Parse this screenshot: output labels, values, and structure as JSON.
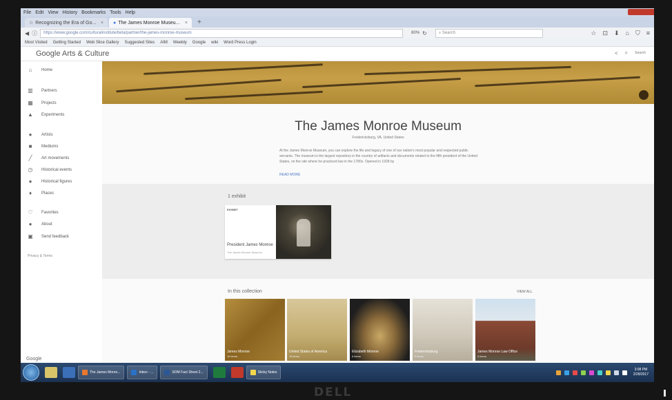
{
  "browser": {
    "menu": [
      "File",
      "Edit",
      "View",
      "History",
      "Bookmarks",
      "Tools",
      "Help"
    ],
    "tabs": [
      {
        "label": "Recognizing the Era of Go...",
        "active": false
      },
      {
        "label": "The James Monroe Museu...",
        "active": true
      }
    ],
    "url": "https://www.google.com/culturalinstitute/beta/partner/the-james-monroe-museum",
    "zoom": "80%",
    "search_placeholder": "Search",
    "bookmarks": [
      "Most Visited",
      "Getting Started",
      "Web Slice Gallery",
      "Suggested Sites",
      "AIM",
      "Weebly",
      "Google",
      "wiki",
      "Word Press Login"
    ]
  },
  "site": {
    "logo": "Google Arts & Culture",
    "search_label": "Search"
  },
  "sidebar": {
    "items": [
      {
        "label": "Home",
        "icon": "home-icon"
      },
      {
        "label": "Partners",
        "icon": "partners-icon"
      },
      {
        "label": "Projects",
        "icon": "projects-icon"
      },
      {
        "label": "Experiments",
        "icon": "experiments-icon"
      },
      {
        "label": "Artists",
        "icon": "person-icon"
      },
      {
        "label": "Mediums",
        "icon": "mediums-icon"
      },
      {
        "label": "Art movements",
        "icon": "brush-icon"
      },
      {
        "label": "Historical events",
        "icon": "clock-icon"
      },
      {
        "label": "Historical figures",
        "icon": "person-icon"
      },
      {
        "label": "Places",
        "icon": "pin-icon"
      },
      {
        "label": "Favorites",
        "icon": "heart-icon"
      },
      {
        "label": "About",
        "icon": "info-icon"
      },
      {
        "label": "Send feedback",
        "icon": "feedback-icon"
      }
    ],
    "privacy": "Privacy & Terms",
    "footer_logo": "Google"
  },
  "museum": {
    "title": "The James Monroe Museum",
    "location": "Fredericksburg, VA, United States",
    "description": "At the James Monroe Museum, you can explore the life and legacy of one of our nation's most popular and respected public servants. The museum is the largest repository in the country of artifacts and documents related to the fifth president of the United States, on the site where he practiced law in the 1780s. Opened in 1928 by",
    "read_more": "READ MORE"
  },
  "exhibits": {
    "heading": "1 exhibit",
    "card": {
      "badge": "EXHIBIT",
      "title": "President James Monroe",
      "subtitle": "The James Monroe Museum"
    }
  },
  "collection": {
    "heading": "In this collection",
    "view_all": "VIEW ALL",
    "items": [
      {
        "label": "James Monroe",
        "count": "16 items"
      },
      {
        "label": "United States of America",
        "count": "15 items"
      },
      {
        "label": "Elizabeth Monroe",
        "count": "6 items"
      },
      {
        "label": "Fredericksburg",
        "count": "5 items"
      },
      {
        "label": "James Monroe Law Office",
        "count": "3 items"
      }
    ]
  },
  "taskbar": {
    "tasks": [
      "The James Monro...",
      "Inbox - ...",
      "SOM Fact Sheet 2..."
    ],
    "sticky": "Sticky Notes",
    "time": "3:08 PM",
    "date": "2/28/2017"
  },
  "monitor": {
    "brand": "DELL"
  }
}
